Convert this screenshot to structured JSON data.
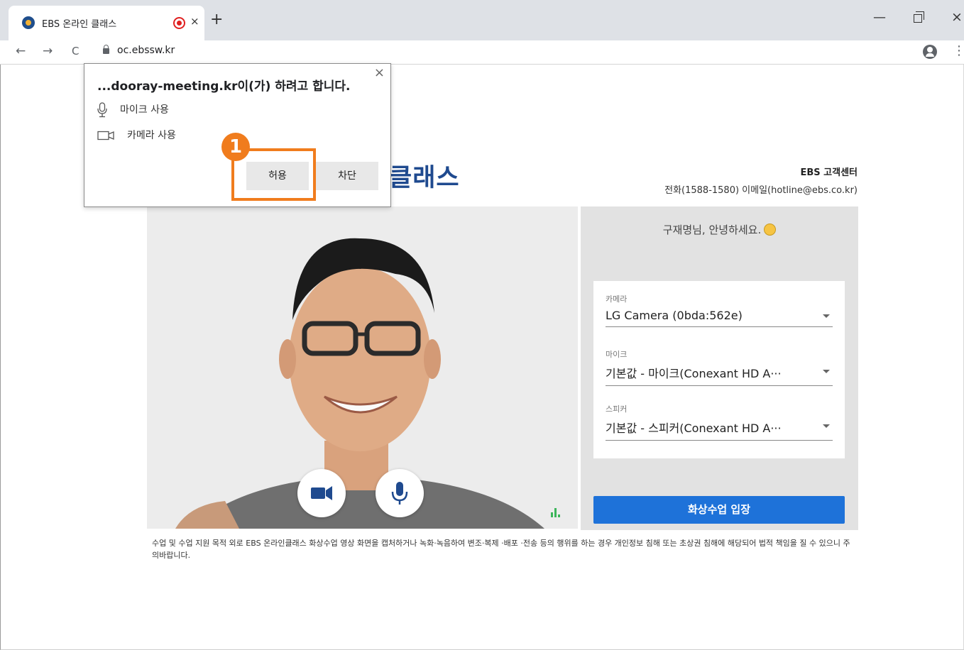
{
  "browser": {
    "tab_title": "EBS 온라인 클래스",
    "tab_close": "×",
    "new_tab": "+",
    "url": "oc.ebssw.kr",
    "nav": {
      "back": "←",
      "forward": "→",
      "reload": "C"
    },
    "window": {
      "minimize": "—",
      "close": "×"
    },
    "menu": "⋮"
  },
  "popup": {
    "title": "...dooray-meeting.kr이(가) 하려고 합니다.",
    "close": "×",
    "permissions": [
      {
        "label": "마이크 사용",
        "icon": "microphone-icon"
      },
      {
        "label": "카메라 사용",
        "icon": "camera-icon"
      }
    ],
    "allow_label": "허용",
    "block_label": "차단"
  },
  "annotation": {
    "step_number": "1",
    "color": "#f07c1d"
  },
  "page": {
    "brand_partial": "클래스",
    "support": {
      "title": "EBS 고객센터",
      "contact": "전화(1588-1580) 이메일(hotline@ebs.co.kr)"
    },
    "greeting": "구재명님, 안녕하세요.",
    "devices": [
      {
        "label": "카메라",
        "value": "LG Camera (0bda:562e)"
      },
      {
        "label": "마이크",
        "value": "기본값 - 마이크(Conexant HD A···"
      },
      {
        "label": "스피커",
        "value": "기본값 - 스피커(Conexant HD A···"
      }
    ],
    "enter_button": "화상수업 입장",
    "notice": "수업 및 수업 지원 목적 외로 EBS 온라인클래스 화상수업 영상 화면을 캡처하거나 녹화·녹음하여 변조·복제 ·배포 ·전송 등의 행위를 하는 경우 개인정보 침해 또는 초상권 침해에 해당되어 법적 책임을 질 수 있으니 주의바랍니다."
  },
  "colors": {
    "accent": "#1e72d9",
    "brand": "#1f4a8f",
    "record": "#e02020",
    "level_indicator": "#3cb55a"
  }
}
